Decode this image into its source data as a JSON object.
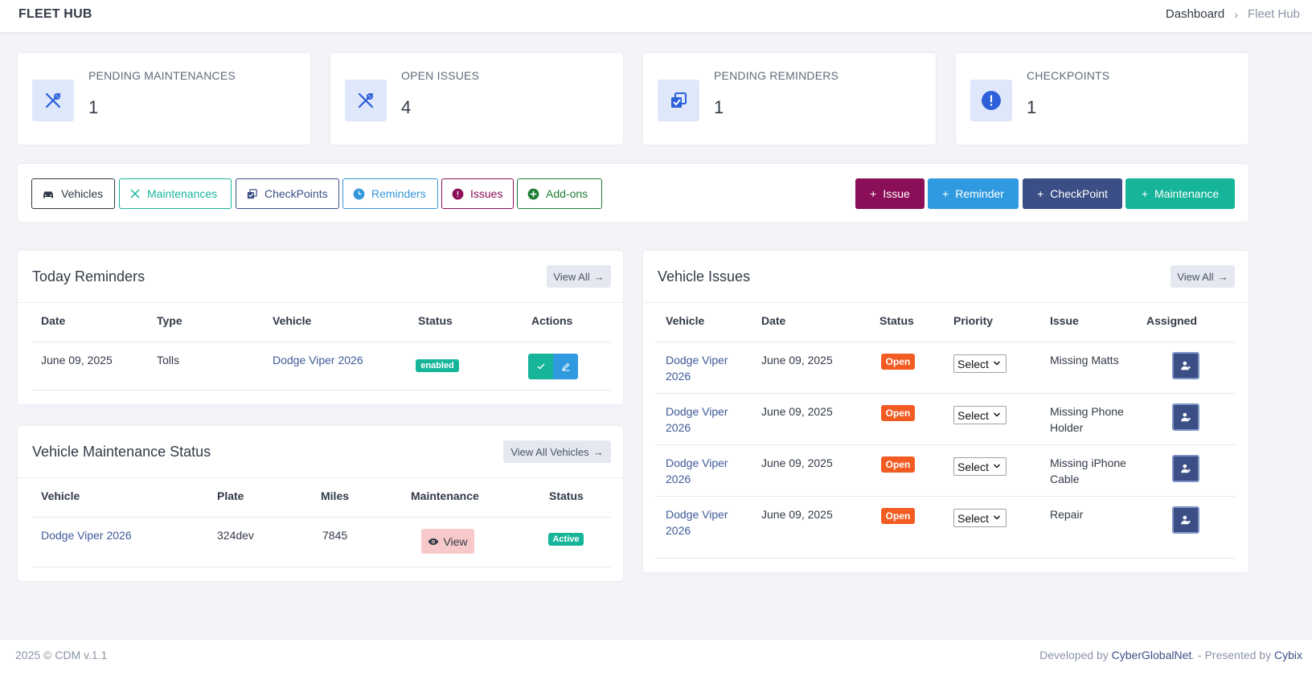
{
  "brand": "FLEET HUB",
  "breadcrumb": {
    "home": "Dashboard",
    "separator": "›",
    "current": "Fleet Hub"
  },
  "stats": [
    {
      "label": "PENDING MAINTENANCES",
      "value": "1",
      "icon": "tools-icon"
    },
    {
      "label": "OPEN ISSUES",
      "value": "4",
      "icon": "tools-icon"
    },
    {
      "label": "PENDING REMINDERS",
      "value": "1",
      "icon": "copy-check-icon"
    },
    {
      "label": "CHECKPOINTS",
      "value": "1",
      "icon": "alert-circle-icon"
    }
  ],
  "tabs": [
    {
      "label": "Vehicles",
      "icon": "car-icon",
      "color": "#313a46"
    },
    {
      "label": "Maintenances",
      "icon": "tools-icon",
      "color": "#16b59a"
    },
    {
      "label": "CheckPoints",
      "icon": "copy-check-icon",
      "color": "#3b4f86"
    },
    {
      "label": "Reminders",
      "icon": "clock-icon",
      "color": "#3498db"
    },
    {
      "label": "Issues",
      "icon": "alert-circle-icon",
      "color": "#8b0f58"
    },
    {
      "label": "Add-ons",
      "icon": "plus-circle-icon",
      "color": "#1e7e34"
    }
  ],
  "actions": [
    {
      "label": "Issue",
      "color": "#8b0f58"
    },
    {
      "label": "Reminder",
      "color": "#2f9ae0"
    },
    {
      "label": "CheckPoint",
      "color": "#3b4f86"
    },
    {
      "label": "Maintenance",
      "color": "#16b59a"
    }
  ],
  "reminders": {
    "title": "Today Reminders",
    "view_all": "View All",
    "columns": [
      "Date",
      "Type",
      "Vehicle",
      "Status",
      "Actions"
    ],
    "rows": [
      {
        "date": "June 09, 2025",
        "type": "Tolls",
        "vehicle": "Dodge Viper 2026",
        "status": "enabled"
      }
    ]
  },
  "maintenance": {
    "title": "Vehicle Maintenance Status",
    "view_all": "View All Vehicles",
    "columns": [
      "Vehicle",
      "Plate",
      "Miles",
      "Maintenance",
      "Status"
    ],
    "rows": [
      {
        "vehicle": "Dodge Viper 2026",
        "plate": "324dev",
        "miles": "7845",
        "maintenance": "View",
        "status": "Active"
      }
    ]
  },
  "issues": {
    "title": "Vehicle Issues",
    "view_all": "View All",
    "columns": [
      "Vehicle",
      "Date",
      "Status",
      "Priority",
      "Issue",
      "Assigned"
    ],
    "rows": [
      {
        "vehicle_l1": "Dodge Viper",
        "vehicle_l2": "2026",
        "date": "June 09, 2025",
        "status": "Open",
        "priority": "Select",
        "issue_l1": "Missing Matts",
        "issue_l2": ""
      },
      {
        "vehicle_l1": "Dodge Viper",
        "vehicle_l2": "2026",
        "date": "June 09, 2025",
        "status": "Open",
        "priority": "Select",
        "issue_l1": "Missing Phone",
        "issue_l2": "Holder"
      },
      {
        "vehicle_l1": "Dodge Viper",
        "vehicle_l2": "2026",
        "date": "June 09, 2025",
        "status": "Open",
        "priority": "Select",
        "issue_l1": "Missing iPhone",
        "issue_l2": "Cable"
      },
      {
        "vehicle_l1": "Dodge Viper",
        "vehicle_l2": "2026",
        "date": "June 09, 2025",
        "status": "Open",
        "priority": "Select",
        "issue_l1": "Repair",
        "issue_l2": ""
      }
    ]
  },
  "footer": {
    "left": "2025 © CDM v.1.1",
    "dev_prefix": "Developed by ",
    "dev_name": "CyberGlobalNet",
    "pres_prefix": ". - Presented by ",
    "pres_name": "Cybix"
  },
  "colors": {
    "accent": "#3b4f86",
    "teal": "#16b59a",
    "blue": "#2f9ae0",
    "plum": "#8b0f58",
    "open": "#f25c23",
    "enabled": "#16b59a"
  }
}
